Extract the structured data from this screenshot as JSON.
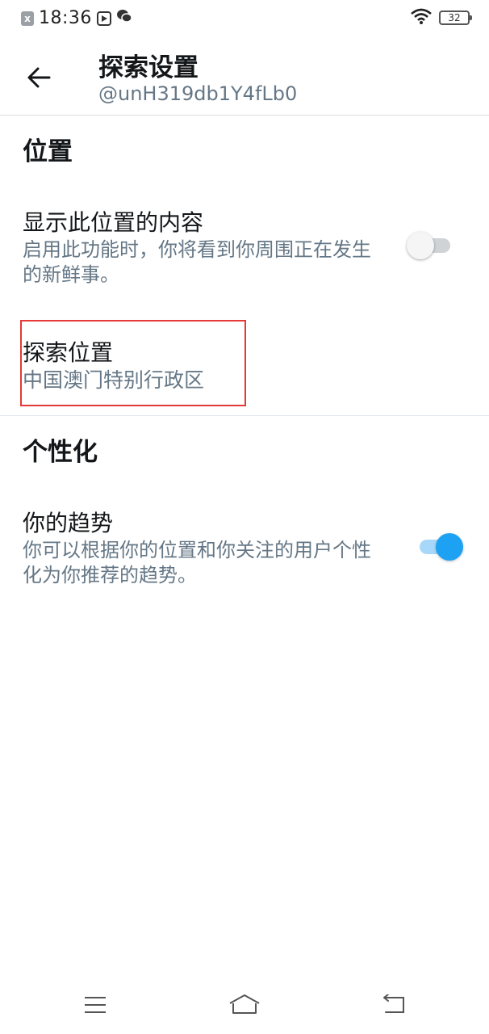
{
  "status_bar": {
    "time": "18:36",
    "battery": "32",
    "icons": [
      "notification-x-icon",
      "media-play-icon",
      "wechat-icon",
      "wifi-icon",
      "battery-icon"
    ]
  },
  "header": {
    "title": "探索设置",
    "subtitle": "@unH319db1Y4fLb0",
    "back_icon": "arrow-left-icon"
  },
  "location_section": {
    "title": "位置",
    "show_content": {
      "label": "显示此位置的内容",
      "description": "启用此功能时，你将看到你周围正在发生的新鲜事。",
      "enabled": false
    },
    "explore_location": {
      "label": "探索位置",
      "value": "中国澳门特别行政区"
    }
  },
  "personalization_section": {
    "title": "个性化",
    "trends": {
      "label": "你的趋势",
      "description": "你可以根据你的位置和你关注的用户个性化为你推荐的趋势。",
      "enabled": true
    }
  },
  "colors": {
    "accent": "#1da1f2",
    "secondary_text": "#657786",
    "highlight": "#e53935"
  },
  "nav_bar": {
    "icons": [
      "menu-icon",
      "home-icon",
      "back-icon"
    ]
  }
}
